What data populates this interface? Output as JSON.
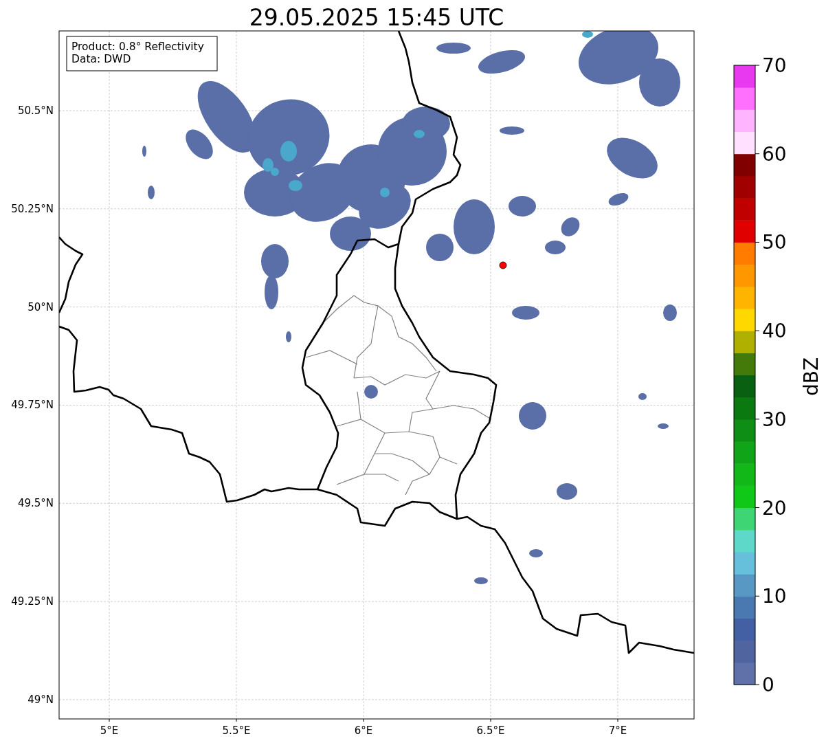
{
  "title": "29.05.2025 15:45 UTC",
  "info_box": [
    "Product: 0.8° Reflectivity",
    "Data: DWD"
  ],
  "map": {
    "x_ticks": [
      "5°E",
      "5.5°E",
      "6°E",
      "6.5°E",
      "7°E"
    ],
    "y_ticks": [
      "50.5°N",
      "50.25°N",
      "50°N",
      "49.75°N",
      "49.5°N",
      "49.25°N",
      "49°N"
    ]
  },
  "colorbar": {
    "label": "dBZ",
    "ticks": [
      "70",
      "60",
      "50",
      "40",
      "30",
      "20",
      "10",
      "0"
    ],
    "bins": [
      {
        "color": "#6070a8"
      },
      {
        "color": "#5064a0"
      },
      {
        "color": "#4460a4"
      },
      {
        "color": "#4a78b0"
      },
      {
        "color": "#5898c4"
      },
      {
        "color": "#66c0dc"
      },
      {
        "color": "#5ed8c8"
      },
      {
        "color": "#3ed674"
      },
      {
        "color": "#10c818"
      },
      {
        "color": "#12b818"
      },
      {
        "color": "#10a418"
      },
      {
        "color": "#0e8e14"
      },
      {
        "color": "#0a7a10"
      },
      {
        "color": "#086010"
      },
      {
        "color": "#447a0a"
      },
      {
        "color": "#b0b000"
      },
      {
        "color": "#ffd800"
      },
      {
        "color": "#ffb400"
      },
      {
        "color": "#ff9800"
      },
      {
        "color": "#ff7c00"
      },
      {
        "color": "#e00000"
      },
      {
        "color": "#c00000"
      },
      {
        "color": "#a00000"
      },
      {
        "color": "#800000"
      },
      {
        "color": "#ffe0ff"
      },
      {
        "color": "#ffb4ff"
      },
      {
        "color": "#ff70ff"
      },
      {
        "color": "#e838f0"
      }
    ]
  }
}
